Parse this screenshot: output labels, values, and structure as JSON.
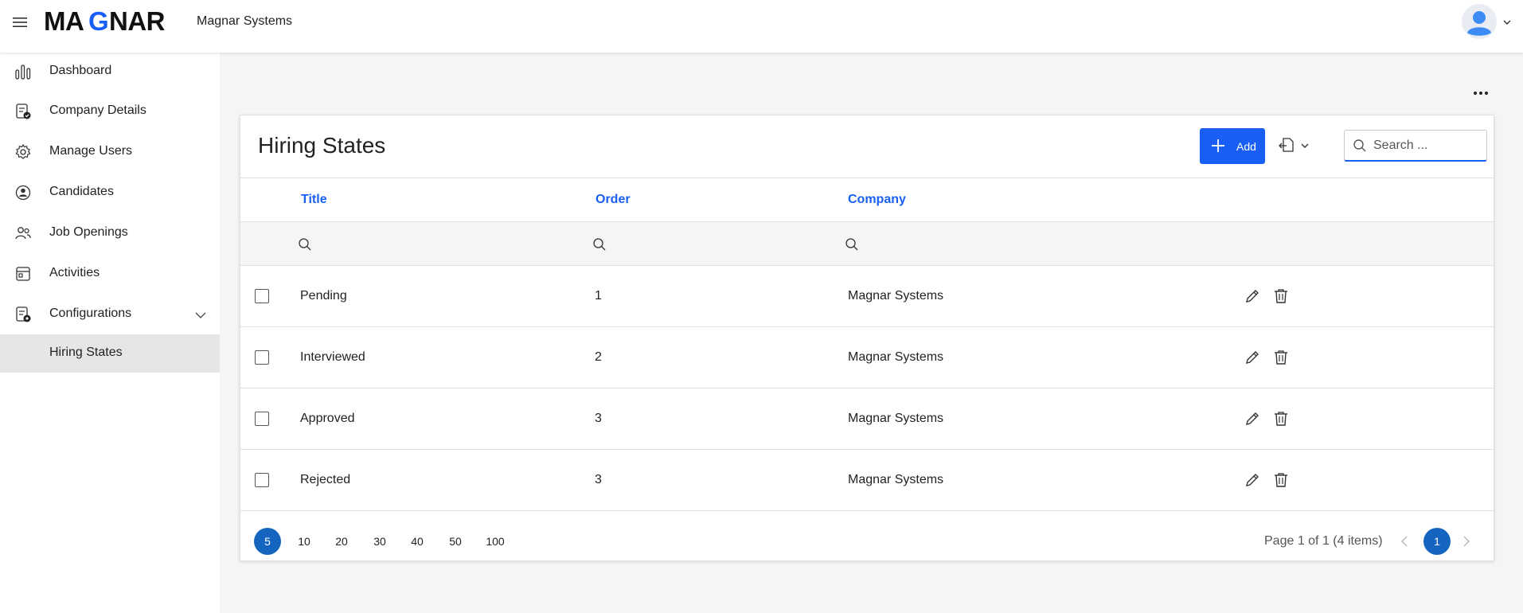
{
  "header": {
    "logo_text": "MAGNAR",
    "company": "Magnar Systems"
  },
  "colors": {
    "accent": "#1a5ff5",
    "pager_selected": "#1565c0",
    "active_nav_bg": "#e6e6e6"
  },
  "sidebar": {
    "items": [
      {
        "label": "Dashboard",
        "icon": "bar-chart-icon"
      },
      {
        "label": "Company Details",
        "icon": "document-check-icon"
      },
      {
        "label": "Manage Users",
        "icon": "gear-icon"
      },
      {
        "label": "Candidates",
        "icon": "user-circle-icon"
      },
      {
        "label": "Job Openings",
        "icon": "users-icon"
      },
      {
        "label": "Activities",
        "icon": "calendar-icon"
      },
      {
        "label": "Configurations",
        "icon": "document-settings-icon",
        "expanded": true
      },
      {
        "label": "Hiring States",
        "active": true
      }
    ]
  },
  "page": {
    "title": "Hiring States",
    "add_label": "Add",
    "search_placeholder": "Search ..."
  },
  "table": {
    "columns": [
      "Title",
      "Order",
      "Company"
    ],
    "rows": [
      {
        "title": "Pending",
        "order": "1",
        "company": "Magnar Systems"
      },
      {
        "title": "Interviewed",
        "order": "2",
        "company": "Magnar Systems"
      },
      {
        "title": "Approved",
        "order": "3",
        "company": "Magnar Systems"
      },
      {
        "title": "Rejected",
        "order": "3",
        "company": "Magnar Systems"
      }
    ]
  },
  "pager": {
    "sizes": [
      "5",
      "10",
      "20",
      "30",
      "40",
      "50",
      "100"
    ],
    "selected_size": "5",
    "info": "Page 1 of 1 (4 items)",
    "current_page": "1"
  }
}
